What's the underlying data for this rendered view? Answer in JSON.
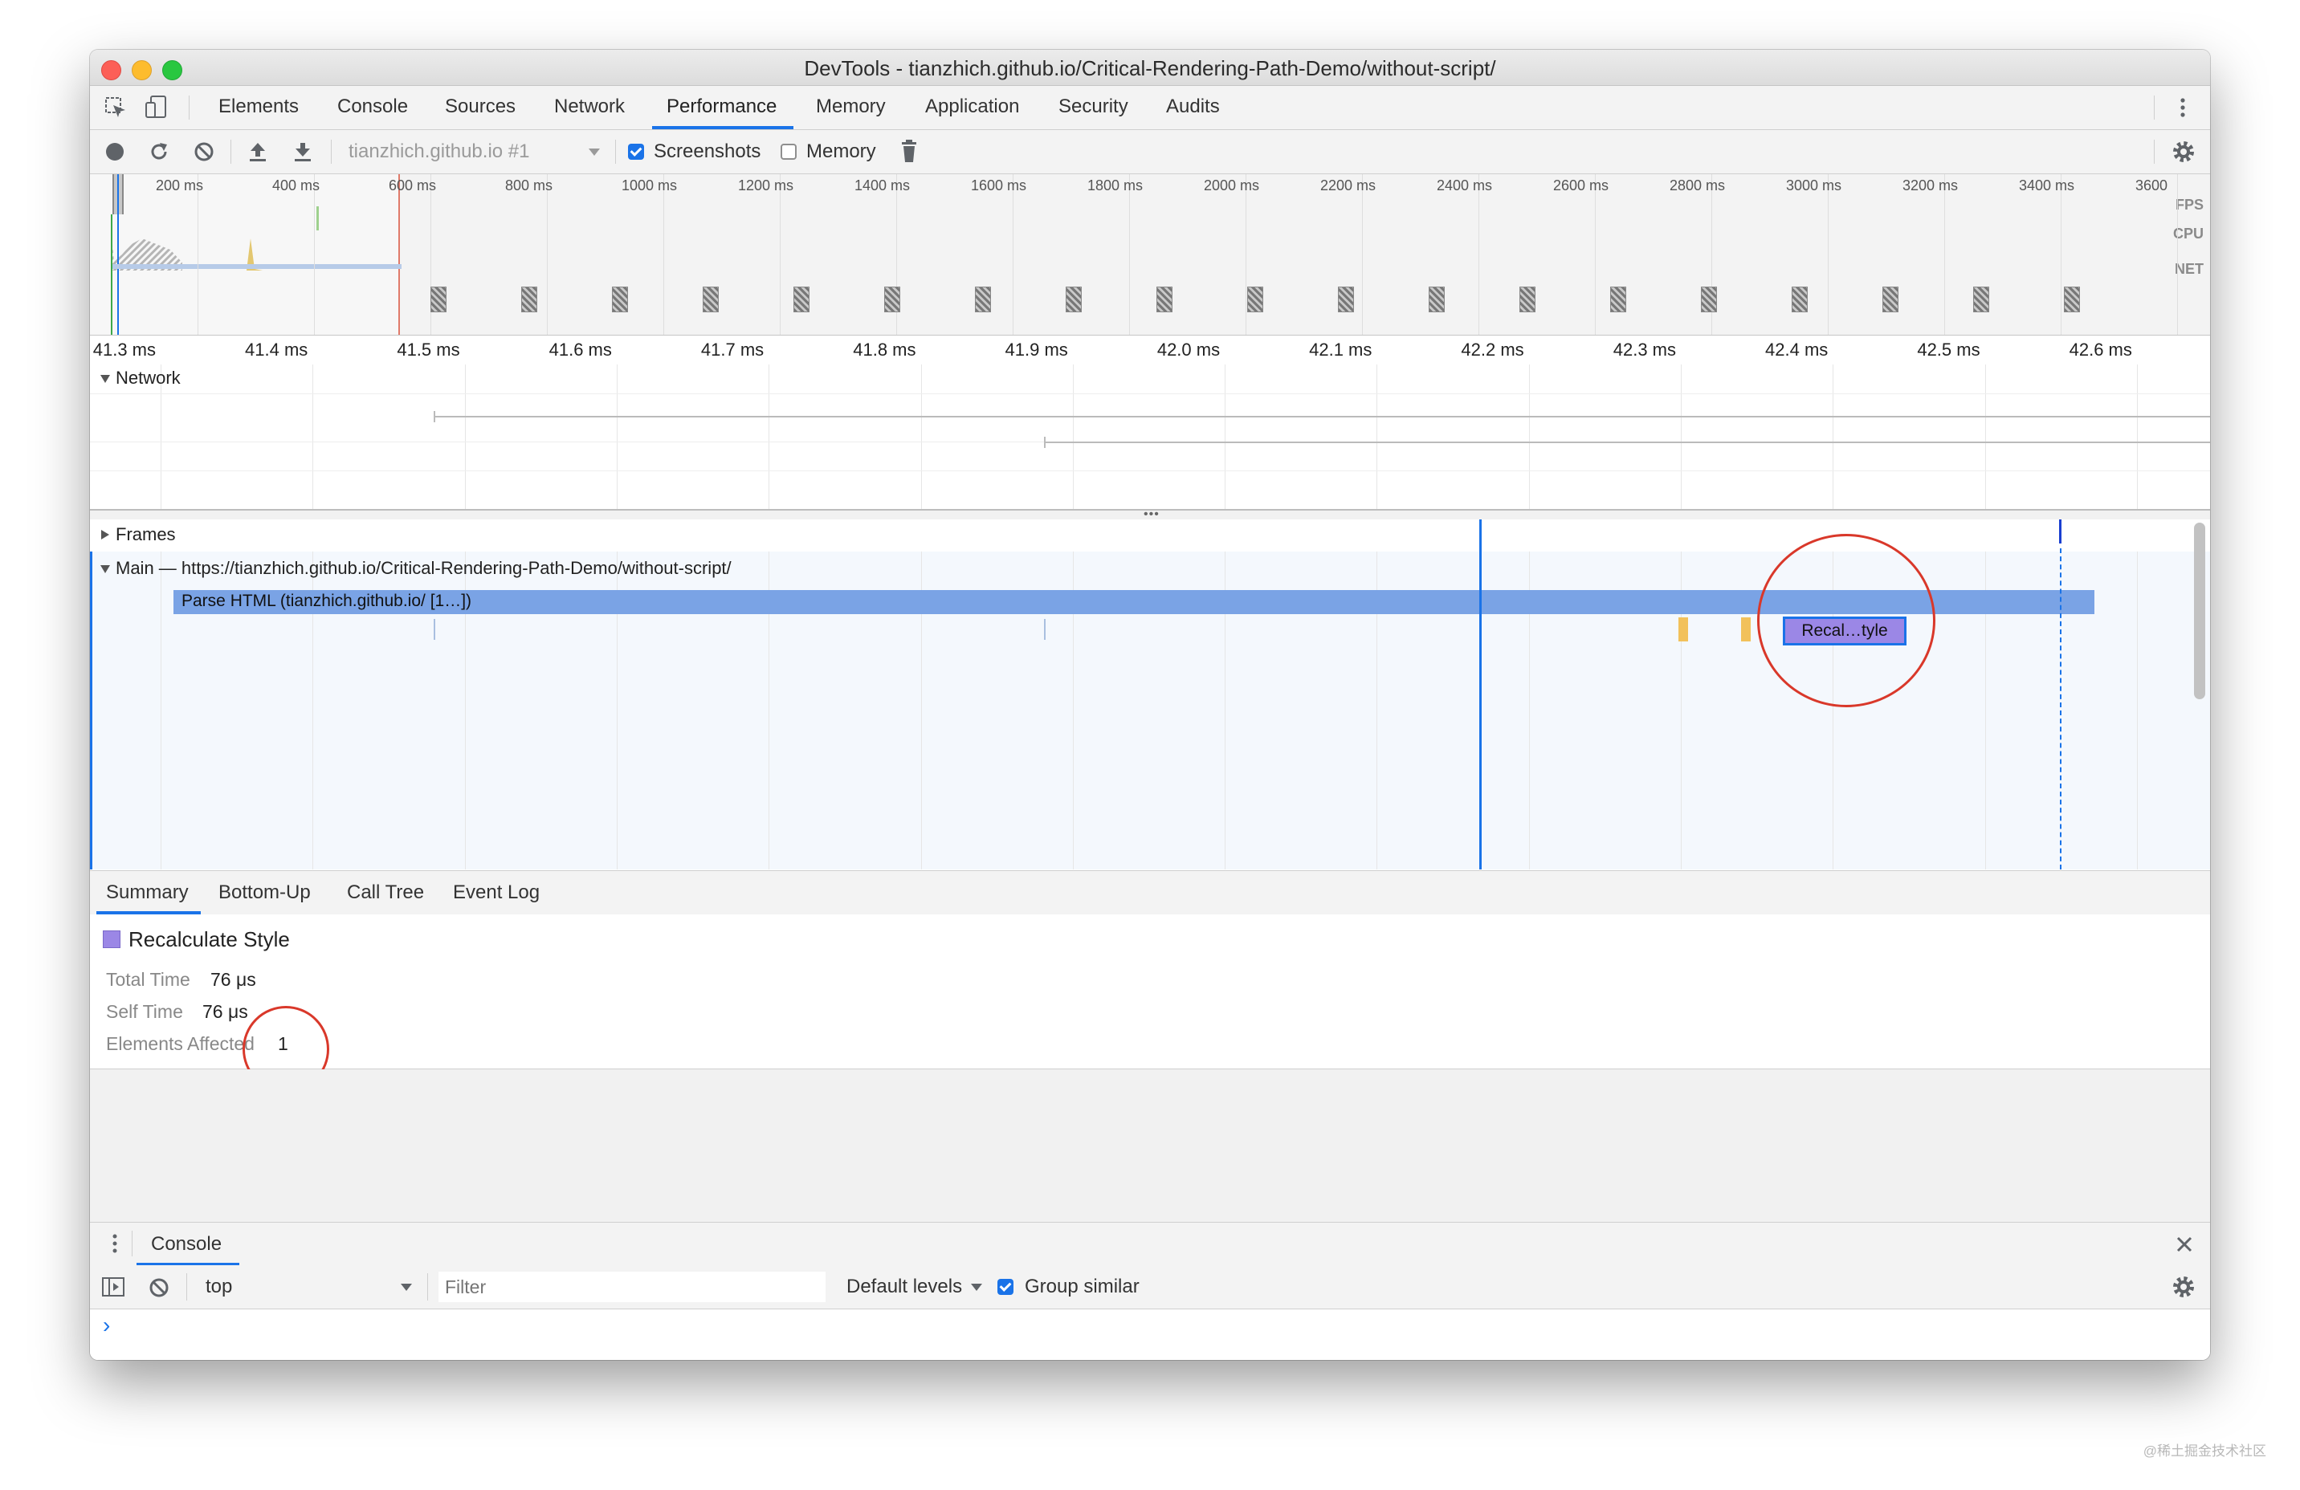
{
  "window": {
    "title": "DevTools - tianzhich.github.io/Critical-Rendering-Path-Demo/without-script/"
  },
  "tabs": [
    {
      "label": "Elements"
    },
    {
      "label": "Console"
    },
    {
      "label": "Sources"
    },
    {
      "label": "Network"
    },
    {
      "label": "Performance",
      "active": true
    },
    {
      "label": "Memory"
    },
    {
      "label": "Application"
    },
    {
      "label": "Security"
    },
    {
      "label": "Audits"
    }
  ],
  "toolbar": {
    "profile_select": "tianzhich.github.io #1",
    "screenshots_label": "Screenshots",
    "screenshots_checked": true,
    "memory_label": "Memory",
    "memory_checked": false
  },
  "overview": {
    "ticks": [
      "200 ms",
      "400 ms",
      "600 ms",
      "800 ms",
      "1000 ms",
      "1200 ms",
      "1400 ms",
      "1600 ms",
      "1800 ms",
      "2000 ms",
      "2200 ms",
      "2400 ms",
      "2600 ms",
      "2800 ms",
      "3000 ms",
      "3200 ms",
      "3400 ms",
      "3600"
    ],
    "labels": {
      "fps": "FPS",
      "cpu": "CPU",
      "net": "NET"
    }
  },
  "ruler": {
    "ticks": [
      "41.3 ms",
      "41.4 ms",
      "41.5 ms",
      "41.6 ms",
      "41.7 ms",
      "41.8 ms",
      "41.9 ms",
      "42.0 ms",
      "42.1 ms",
      "42.2 ms",
      "42.3 ms",
      "42.4 ms",
      "42.5 ms",
      "42.6 ms"
    ]
  },
  "tracks": {
    "network": "Network",
    "frames": "Frames",
    "main": "Main — https://tianzhich.github.io/Critical-Rendering-Path-Demo/without-script/"
  },
  "flame": {
    "parse_html": "Parse HTML (tianzhich.github.io/ [1…])",
    "recalc_style": "Recal…tyle"
  },
  "bottom_tabs": [
    {
      "label": "Summary",
      "active": true
    },
    {
      "label": "Bottom-Up"
    },
    {
      "label": "Call Tree"
    },
    {
      "label": "Event Log"
    }
  ],
  "summary": {
    "title": "Recalculate Style",
    "swatch_color": "#9b87e6",
    "rows": [
      {
        "label": "Total Time",
        "value": "76 μs"
      },
      {
        "label": "Self Time",
        "value": "76 μs"
      },
      {
        "label": "Elements Affected",
        "value": "1"
      }
    ]
  },
  "drawer": {
    "tab": "Console",
    "context": "top",
    "filter_placeholder": "Filter",
    "levels": "Default levels",
    "group_similar_label": "Group similar",
    "group_similar_checked": true,
    "prompt": "›"
  },
  "colors": {
    "accent": "#1a73e8",
    "parse_html": "#7aa3e5",
    "recalc": "#9b87e6",
    "annotation": "#d9382a"
  },
  "watermark": "@稀土掘金技术社区"
}
